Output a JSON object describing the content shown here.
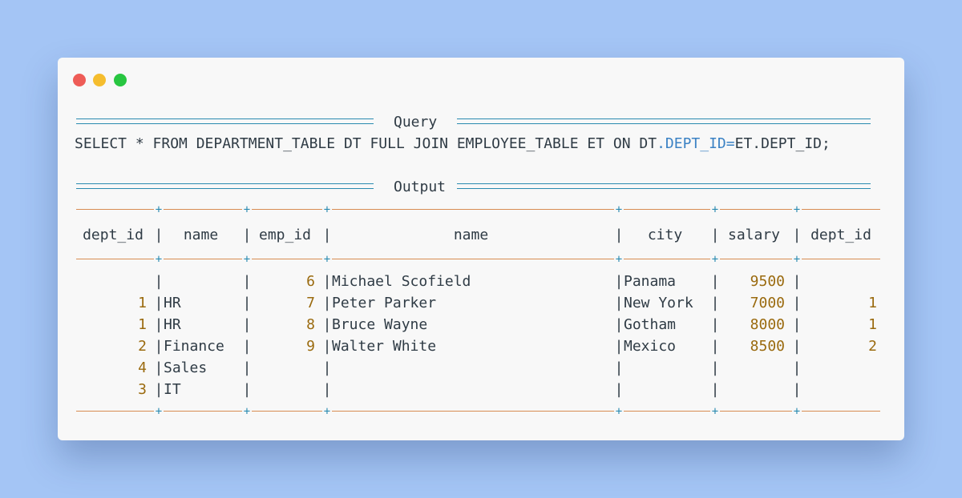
{
  "window": {
    "controls": [
      "close",
      "minimize",
      "maximize"
    ]
  },
  "query_section": {
    "label": "Query",
    "sql_before": "SELECT * FROM DEPARTMENT_TABLE DT FULL JOIN EMPLOYEE_TABLE ET ON DT",
    "sql_highlight": ".DEPT_ID=",
    "sql_after": "ET.DEPT_ID;"
  },
  "output_section": {
    "label": "Output"
  },
  "table": {
    "columns": [
      "dept_id",
      "name",
      "emp_id",
      "name",
      "city",
      "salary",
      "dept_id"
    ],
    "rows": [
      [
        "",
        "",
        "6",
        "Michael Scofield",
        "Panama",
        "9500",
        ""
      ],
      [
        "1",
        "HR",
        "7",
        "Peter Parker",
        "New York",
        "7000",
        "1"
      ],
      [
        "1",
        "HR",
        "8",
        "Bruce Wayne",
        "Gotham",
        "8000",
        "1"
      ],
      [
        "2",
        "Finance",
        "9",
        "Walter White",
        "Mexico",
        "8500",
        "2"
      ],
      [
        "4",
        "Sales",
        "",
        "",
        "",
        "",
        ""
      ],
      [
        "3",
        "IT",
        "",
        "",
        "",
        "",
        ""
      ]
    ]
  },
  "colors": {
    "background": "#a4c5f5",
    "window": "#f8f8f8",
    "text": "#2f3b45",
    "number": "#9a6a0e",
    "highlight": "#3b82c4",
    "rule_double": "#2a8ab0",
    "rule_table": "#d88c52",
    "close": "#ee5c57",
    "minimize": "#f5bd2e",
    "maximize": "#28c641"
  }
}
